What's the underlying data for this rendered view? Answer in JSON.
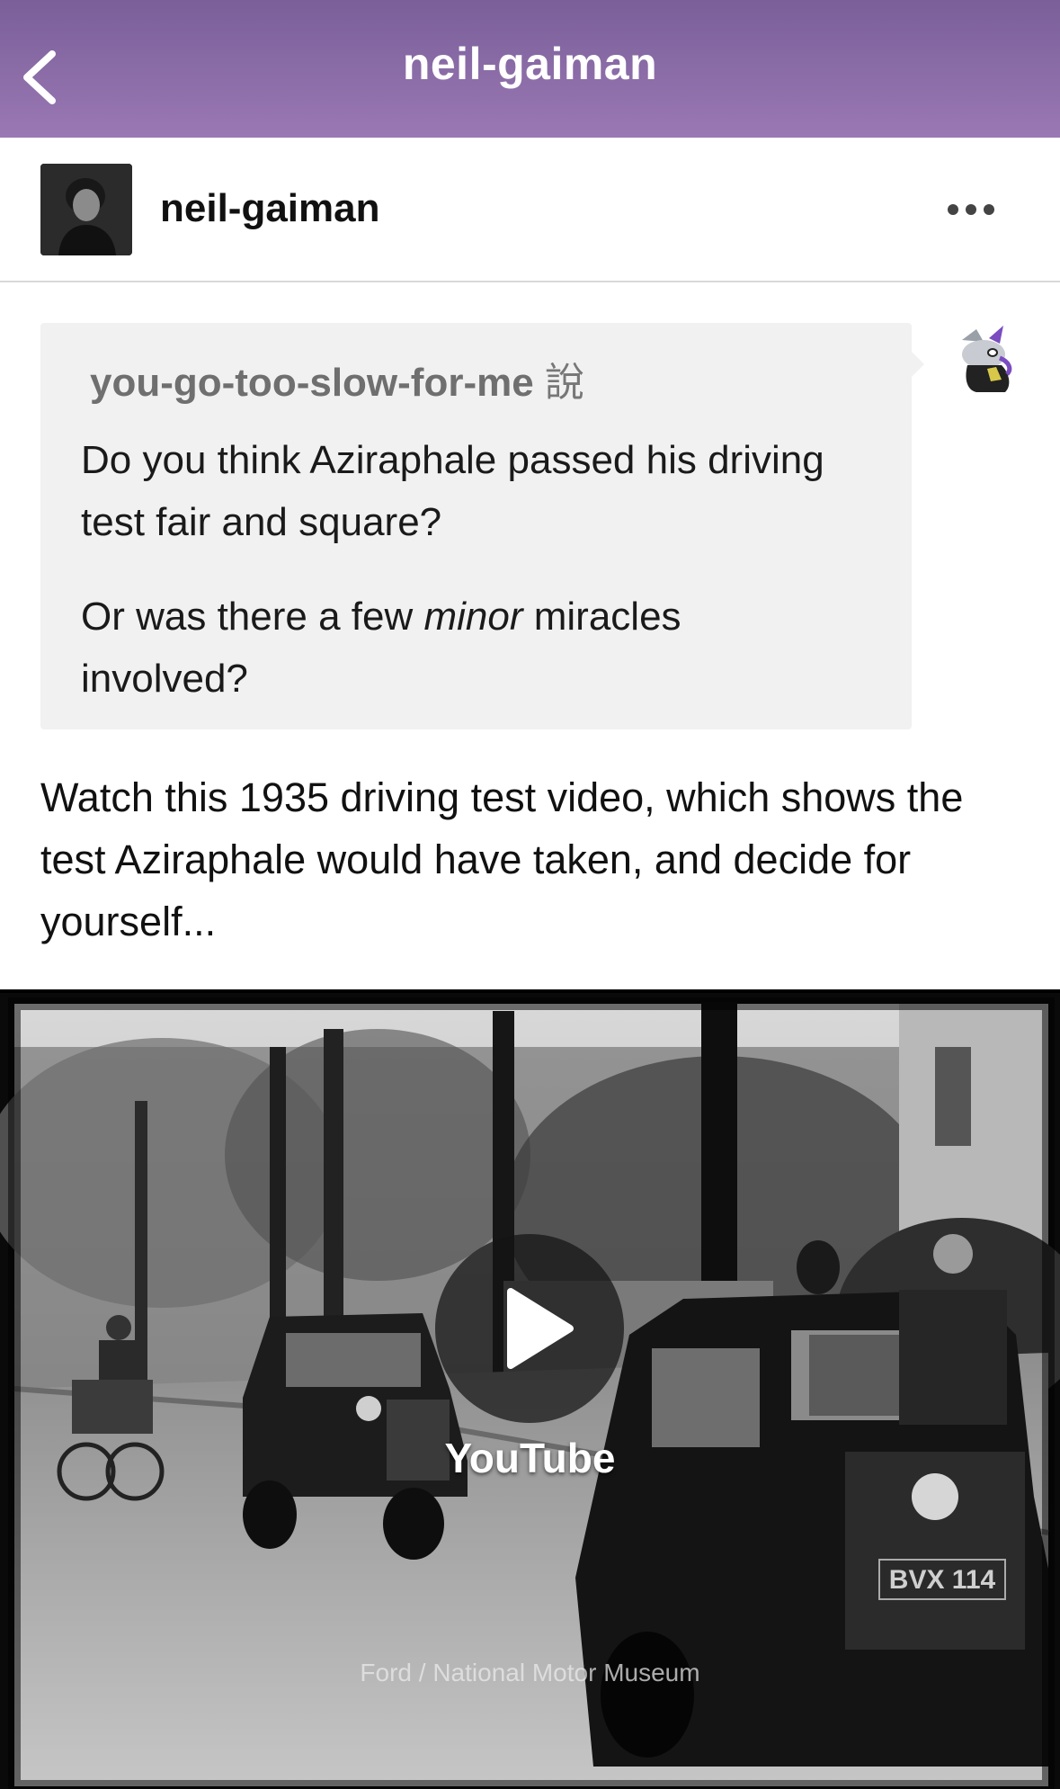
{
  "topbar": {
    "title": "neil-gaiman",
    "back_icon": "chevron-left-icon"
  },
  "post": {
    "author": "neil-gaiman",
    "more_icon": "more-horizontal-icon"
  },
  "ask": {
    "asker": "you-go-too-slow-for-me",
    "asker_suffix": "說",
    "paragraph_1": "Do you think Aziraphale passed his driving test fair and square?",
    "paragraph_2_before": "Or was there a few ",
    "paragraph_2_em": "minor",
    "paragraph_2_after": " miracles involved?"
  },
  "answer": {
    "text": "Watch this 1935 driving test video, which shows the test Aziraphale would have taken, and decide for yourself..."
  },
  "video": {
    "provider_label": "YouTube",
    "plate": "BVX 114",
    "credit": "Ford / National Motor Museum",
    "play_icon": "play-icon"
  },
  "colors": {
    "topbar": "#8a6aa8",
    "ask_bg": "#f1f1f1",
    "asker_text": "#6f6f6f"
  }
}
